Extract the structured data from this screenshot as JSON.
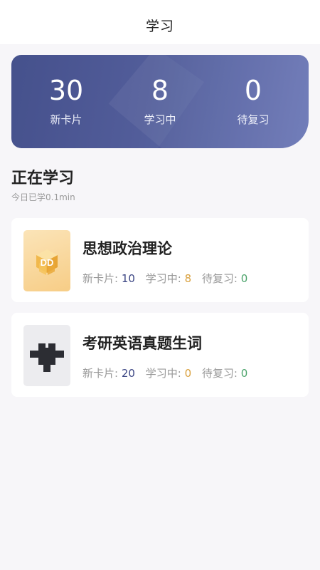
{
  "header": {
    "title": "学习"
  },
  "summary": {
    "new_cards": {
      "value": "30",
      "label": "新卡片"
    },
    "learning": {
      "value": "8",
      "label": "学习中"
    },
    "to_review": {
      "value": "0",
      "label": "待复习"
    }
  },
  "section": {
    "title": "正在学习",
    "subtitle": "今日已学0.1min"
  },
  "decks": [
    {
      "name": "思想政治理论",
      "new_label": "新卡片:",
      "new_value": "10",
      "learning_label": "学习中:",
      "learning_value": "8",
      "review_label": "待复习:",
      "review_value": "0",
      "thumb_text": "DD"
    },
    {
      "name": "考研英语真题生词",
      "new_label": "新卡片:",
      "new_value": "20",
      "learning_label": "学习中:",
      "learning_value": "0",
      "review_label": "待复习:",
      "review_value": "0"
    }
  ],
  "colors": {
    "banner_start": "#3e4a88",
    "banner_end": "#6a76b6",
    "new_count": "#3c4684",
    "learning_count": "#d9a13f",
    "review_count": "#4ba36a"
  },
  "icons": [
    "cube-logo-icon",
    "pixel-logo-icon"
  ]
}
